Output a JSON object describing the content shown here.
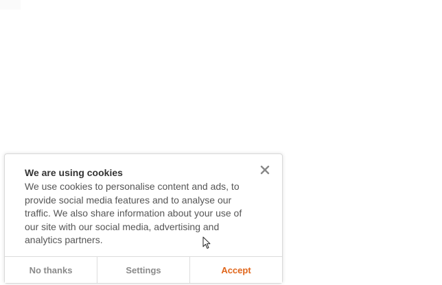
{
  "cookie_dialog": {
    "title": "We are using cookies",
    "message": "We use cookies to personalise content and ads, to provide social media features and to analyse our traffic. We also share information about your use of our site with our social media, advertising and analytics partners.",
    "close_icon": "close-icon",
    "buttons": {
      "no_thanks": "No thanks",
      "settings": "Settings",
      "accept": "Accept"
    }
  },
  "colors": {
    "accent": "#e0651a",
    "secondary_button_text": "#8a8a8a",
    "title_text": "#333333",
    "body_text": "#555555"
  }
}
